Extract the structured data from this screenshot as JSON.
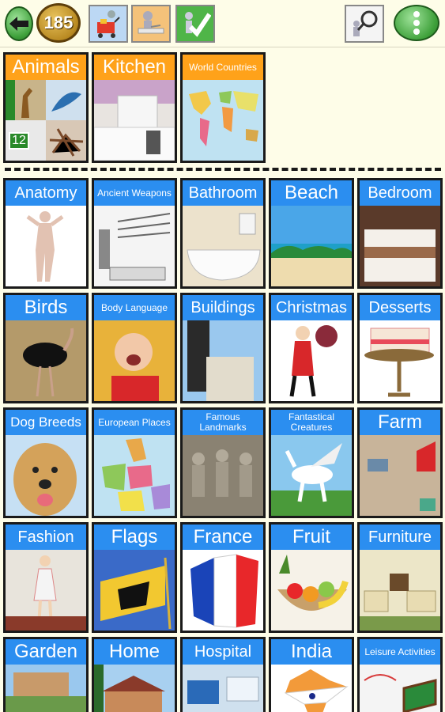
{
  "toolbar": {
    "coins": "185",
    "icons": [
      "back-arrow-icon",
      "coin-icon",
      "shop-cart-icon",
      "reading-desk-icon",
      "checkmark-person-icon",
      "magnifier-person-icon",
      "more-options-icon"
    ]
  },
  "featured": [
    {
      "label": "Animals",
      "badge": "12",
      "color": "orange"
    },
    {
      "label": "Kitchen",
      "color": "orange"
    },
    {
      "label": "World Countries",
      "color": "orange"
    }
  ],
  "categories": [
    [
      "Anatomy",
      "Ancient Weapons",
      "Bathroom",
      "Beach",
      "Bedroom"
    ],
    [
      "Birds",
      "Body Language",
      "Buildings",
      "Christmas",
      "Desserts"
    ],
    [
      "Dog Breeds",
      "European Places",
      "Famous Landmarks",
      "Fantastical Creatures",
      "Farm"
    ],
    [
      "Fashion",
      "Flags",
      "France",
      "Fruit",
      "Furniture"
    ],
    [
      "Garden",
      "Home",
      "Hospital",
      "India",
      "Leisure Activities"
    ]
  ]
}
